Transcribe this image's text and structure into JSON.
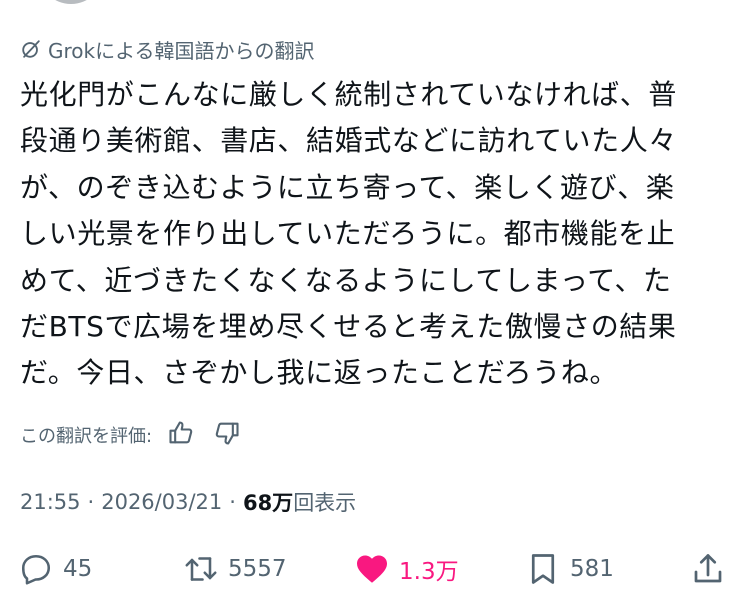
{
  "translation": {
    "icon": "grok-icon",
    "label": "Grokによる韓国語からの翻訳"
  },
  "post": {
    "lines": [
      "光化門がこんなに厳しく統制されていなければ、普",
      "段通り美術館、書店、結婚式などに訪れていた人々",
      "が、のぞき込むように立ち寄って、楽しく遊び、楽",
      "しい光景を作り出していただろうに。都市機能を止",
      "めて、近づきたくなくなるようにしてしまって、た",
      "だBTSで広場を埋め尽くせると考えた傲慢さの結果",
      "だ。今日、さぞかし我に返ったことだろうね。"
    ]
  },
  "rating": {
    "label": "この翻訳を評価:",
    "icons": [
      "thumbs-up-icon",
      "thumbs-down-icon"
    ]
  },
  "meta": {
    "time": "21:55",
    "separator": "·",
    "date": "2026/03/21",
    "views_count": "68万",
    "views_label": "回表示"
  },
  "actions": {
    "reply_count": "45",
    "repost_count": "5557",
    "like_count": "1.3万",
    "bookmark_count": "581"
  },
  "colors": {
    "text": "#0f1419",
    "secondary": "#536471",
    "like": "#f91880"
  }
}
